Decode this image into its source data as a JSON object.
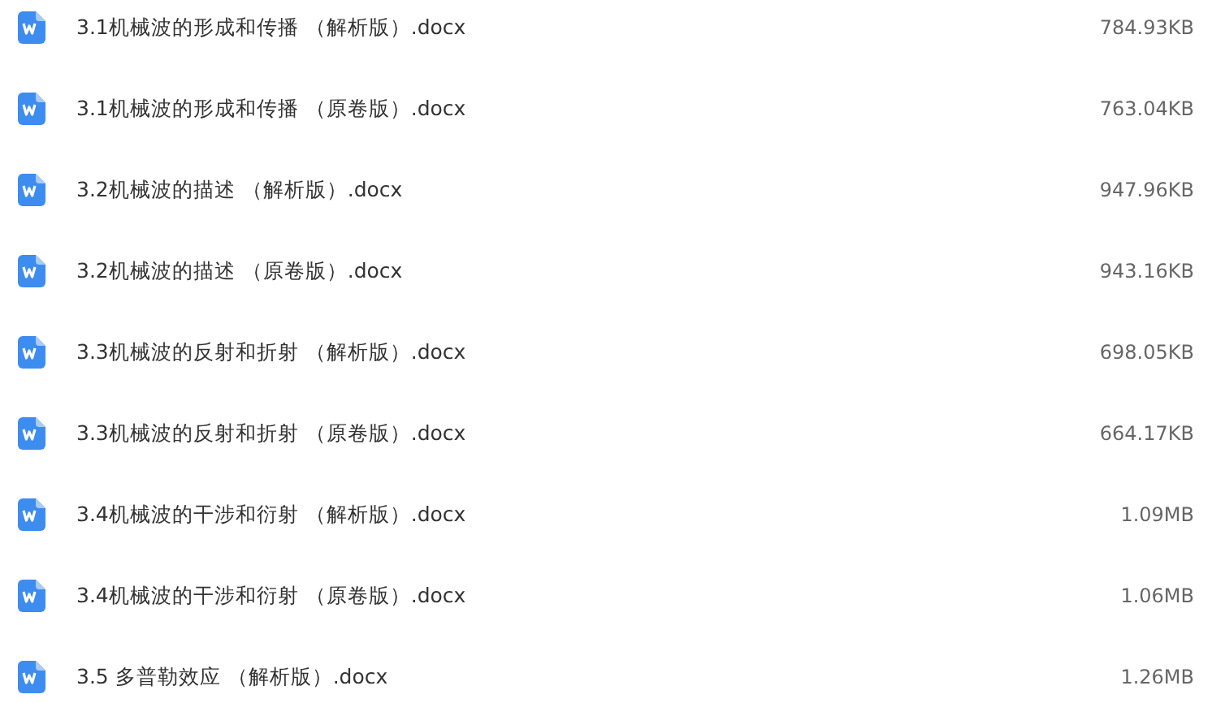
{
  "files": [
    {
      "name": "3.1机械波的形成和传播 （解析版）.docx",
      "size": "784.93KB"
    },
    {
      "name": "3.1机械波的形成和传播 （原卷版）.docx",
      "size": "763.04KB"
    },
    {
      "name": "3.2机械波的描述 （解析版）.docx",
      "size": "947.96KB"
    },
    {
      "name": "3.2机械波的描述 （原卷版）.docx",
      "size": "943.16KB"
    },
    {
      "name": "3.3机械波的反射和折射 （解析版）.docx",
      "size": "698.05KB"
    },
    {
      "name": "3.3机械波的反射和折射 （原卷版）.docx",
      "size": "664.17KB"
    },
    {
      "name": "3.4机械波的干涉和衍射 （解析版）.docx",
      "size": "1.09MB"
    },
    {
      "name": "3.4机械波的干涉和衍射 （原卷版）.docx",
      "size": "1.06MB"
    },
    {
      "name": "3.5 多普勒效应 （解析版）.docx",
      "size": "1.26MB"
    }
  ]
}
